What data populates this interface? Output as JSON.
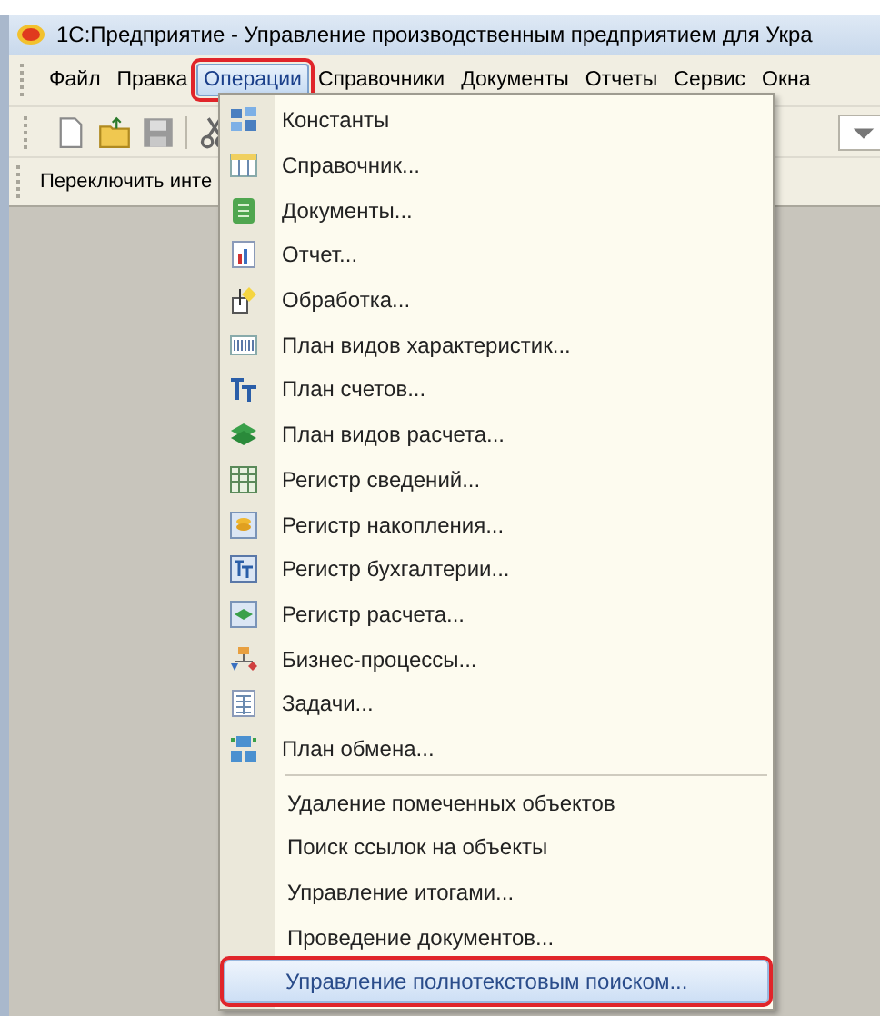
{
  "window": {
    "title": "1С:Предприятие - Управление производственным предприятием для Укра"
  },
  "menu_bar": [
    {
      "label": "Файл",
      "selected": false
    },
    {
      "label": "Правка",
      "selected": false
    },
    {
      "label": "Операции",
      "selected": true
    },
    {
      "label": "Справочники",
      "selected": false
    },
    {
      "label": "Документы",
      "selected": false
    },
    {
      "label": "Отчеты",
      "selected": false
    },
    {
      "label": "Сервис",
      "selected": false
    },
    {
      "label": "Окна",
      "selected": false
    }
  ],
  "panel_button": {
    "label": "Переключить инте"
  },
  "operations_menu": {
    "object_items": [
      {
        "label": "Константы",
        "selected": false
      },
      {
        "label": "Справочник...",
        "selected": false
      },
      {
        "label": "Документы...",
        "selected": false
      },
      {
        "label": "Отчет...",
        "selected": false
      },
      {
        "label": "Обработка...",
        "selected": false
      },
      {
        "label": "План видов характеристик...",
        "selected": false
      },
      {
        "label": "План счетов...",
        "selected": false
      },
      {
        "label": "План видов расчета...",
        "selected": false
      },
      {
        "label": "Регистр сведений...",
        "selected": false
      },
      {
        "label": "Регистр накопления...",
        "selected": false
      },
      {
        "label": "Регистр бухгалтерии...",
        "selected": false
      },
      {
        "label": "Регистр расчета...",
        "selected": false
      },
      {
        "label": "Бизнес-процессы...",
        "selected": false
      },
      {
        "label": "Задачи...",
        "selected": false
      },
      {
        "label": "План обмена...",
        "selected": false
      }
    ],
    "service_items": [
      {
        "label": "Удаление помеченных объектов",
        "selected": false
      },
      {
        "label": "Поиск ссылок на объекты",
        "selected": false
      },
      {
        "label": "Управление итогами...",
        "selected": false
      },
      {
        "label": "Проведение документов...",
        "selected": false
      },
      {
        "label": "Управление полнотекстовым поиском...",
        "selected": true
      }
    ]
  }
}
